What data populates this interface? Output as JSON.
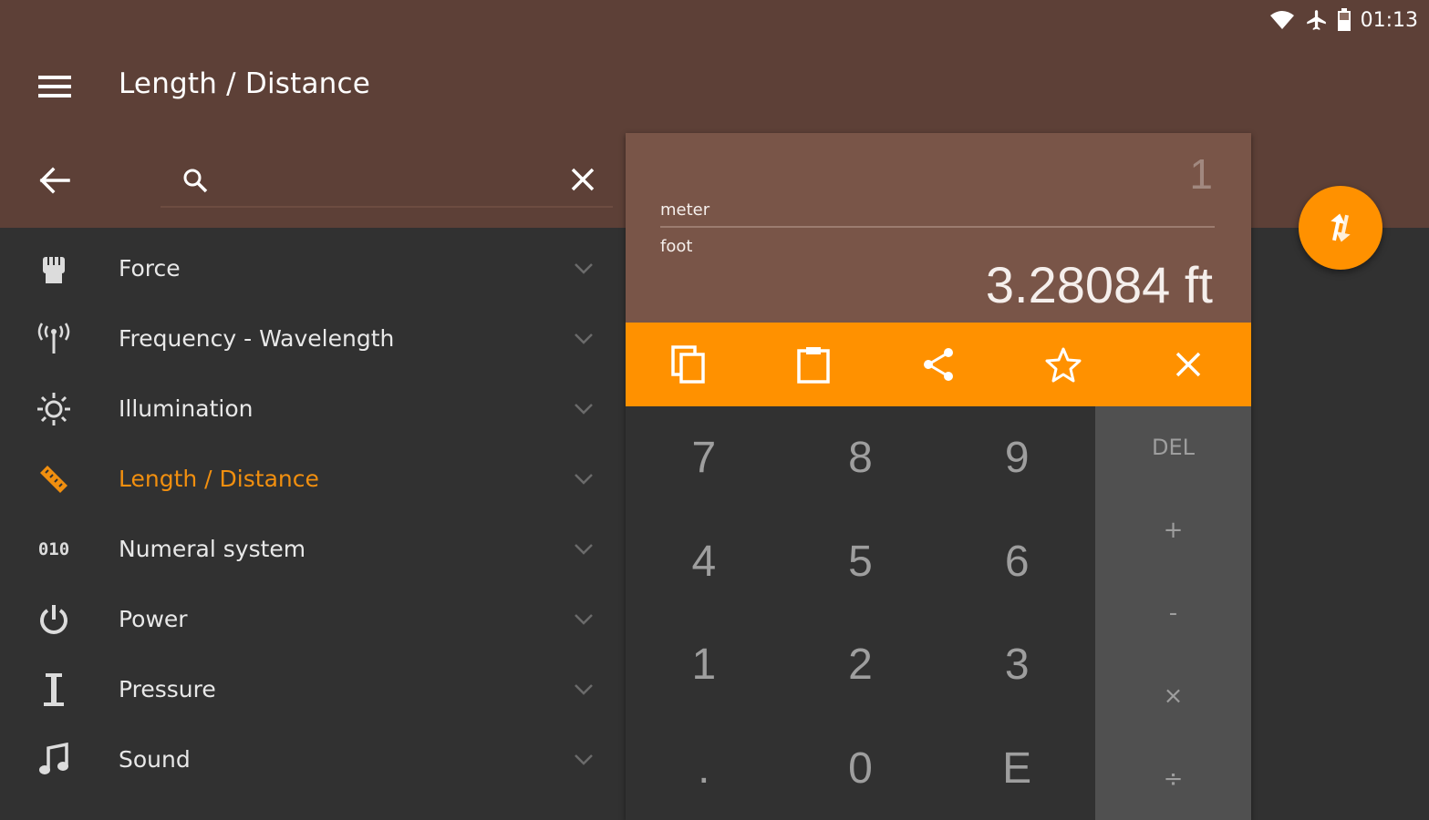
{
  "status_bar": {
    "time": "01:13",
    "icons": [
      "wifi-icon",
      "airplane-icon",
      "battery-icon"
    ]
  },
  "app_bar": {
    "title": "Length / Distance",
    "menu_icon": "menu-icon"
  },
  "search": {
    "placeholder": "",
    "value": ""
  },
  "categories": [
    {
      "label": "Force",
      "icon": "fist-icon",
      "active": false
    },
    {
      "label": "Frequency - Wavelength",
      "icon": "antenna-icon",
      "active": false
    },
    {
      "label": "Illumination",
      "icon": "sun-icon",
      "active": false
    },
    {
      "label": "Length / Distance",
      "icon": "ruler-icon",
      "active": true
    },
    {
      "label": "Numeral system",
      "icon": "binary-icon",
      "code": "010",
      "active": false
    },
    {
      "label": "Power",
      "icon": "power-icon",
      "active": false
    },
    {
      "label": "Pressure",
      "icon": "pressure-icon",
      "active": false
    },
    {
      "label": "Sound",
      "icon": "music-note-icon",
      "active": false
    }
  ],
  "converter": {
    "input_value": "1",
    "from_unit": "meter",
    "to_unit": "foot",
    "result": "3.28084 ft"
  },
  "actions": [
    "copy-icon",
    "paste-icon",
    "share-icon",
    "star-icon",
    "close-icon"
  ],
  "keypad": {
    "keys": [
      "7",
      "8",
      "9",
      "4",
      "5",
      "6",
      "1",
      "2",
      "3",
      ".",
      "0",
      "E"
    ],
    "ops": [
      "DEL",
      "+",
      "-",
      "×",
      "÷"
    ]
  },
  "colors": {
    "app_bar": "#5d4037",
    "converter": "#795548",
    "accent": "#ff9100",
    "active_text": "#f18f0f",
    "background": "#313131",
    "ops_panel": "#505050"
  }
}
